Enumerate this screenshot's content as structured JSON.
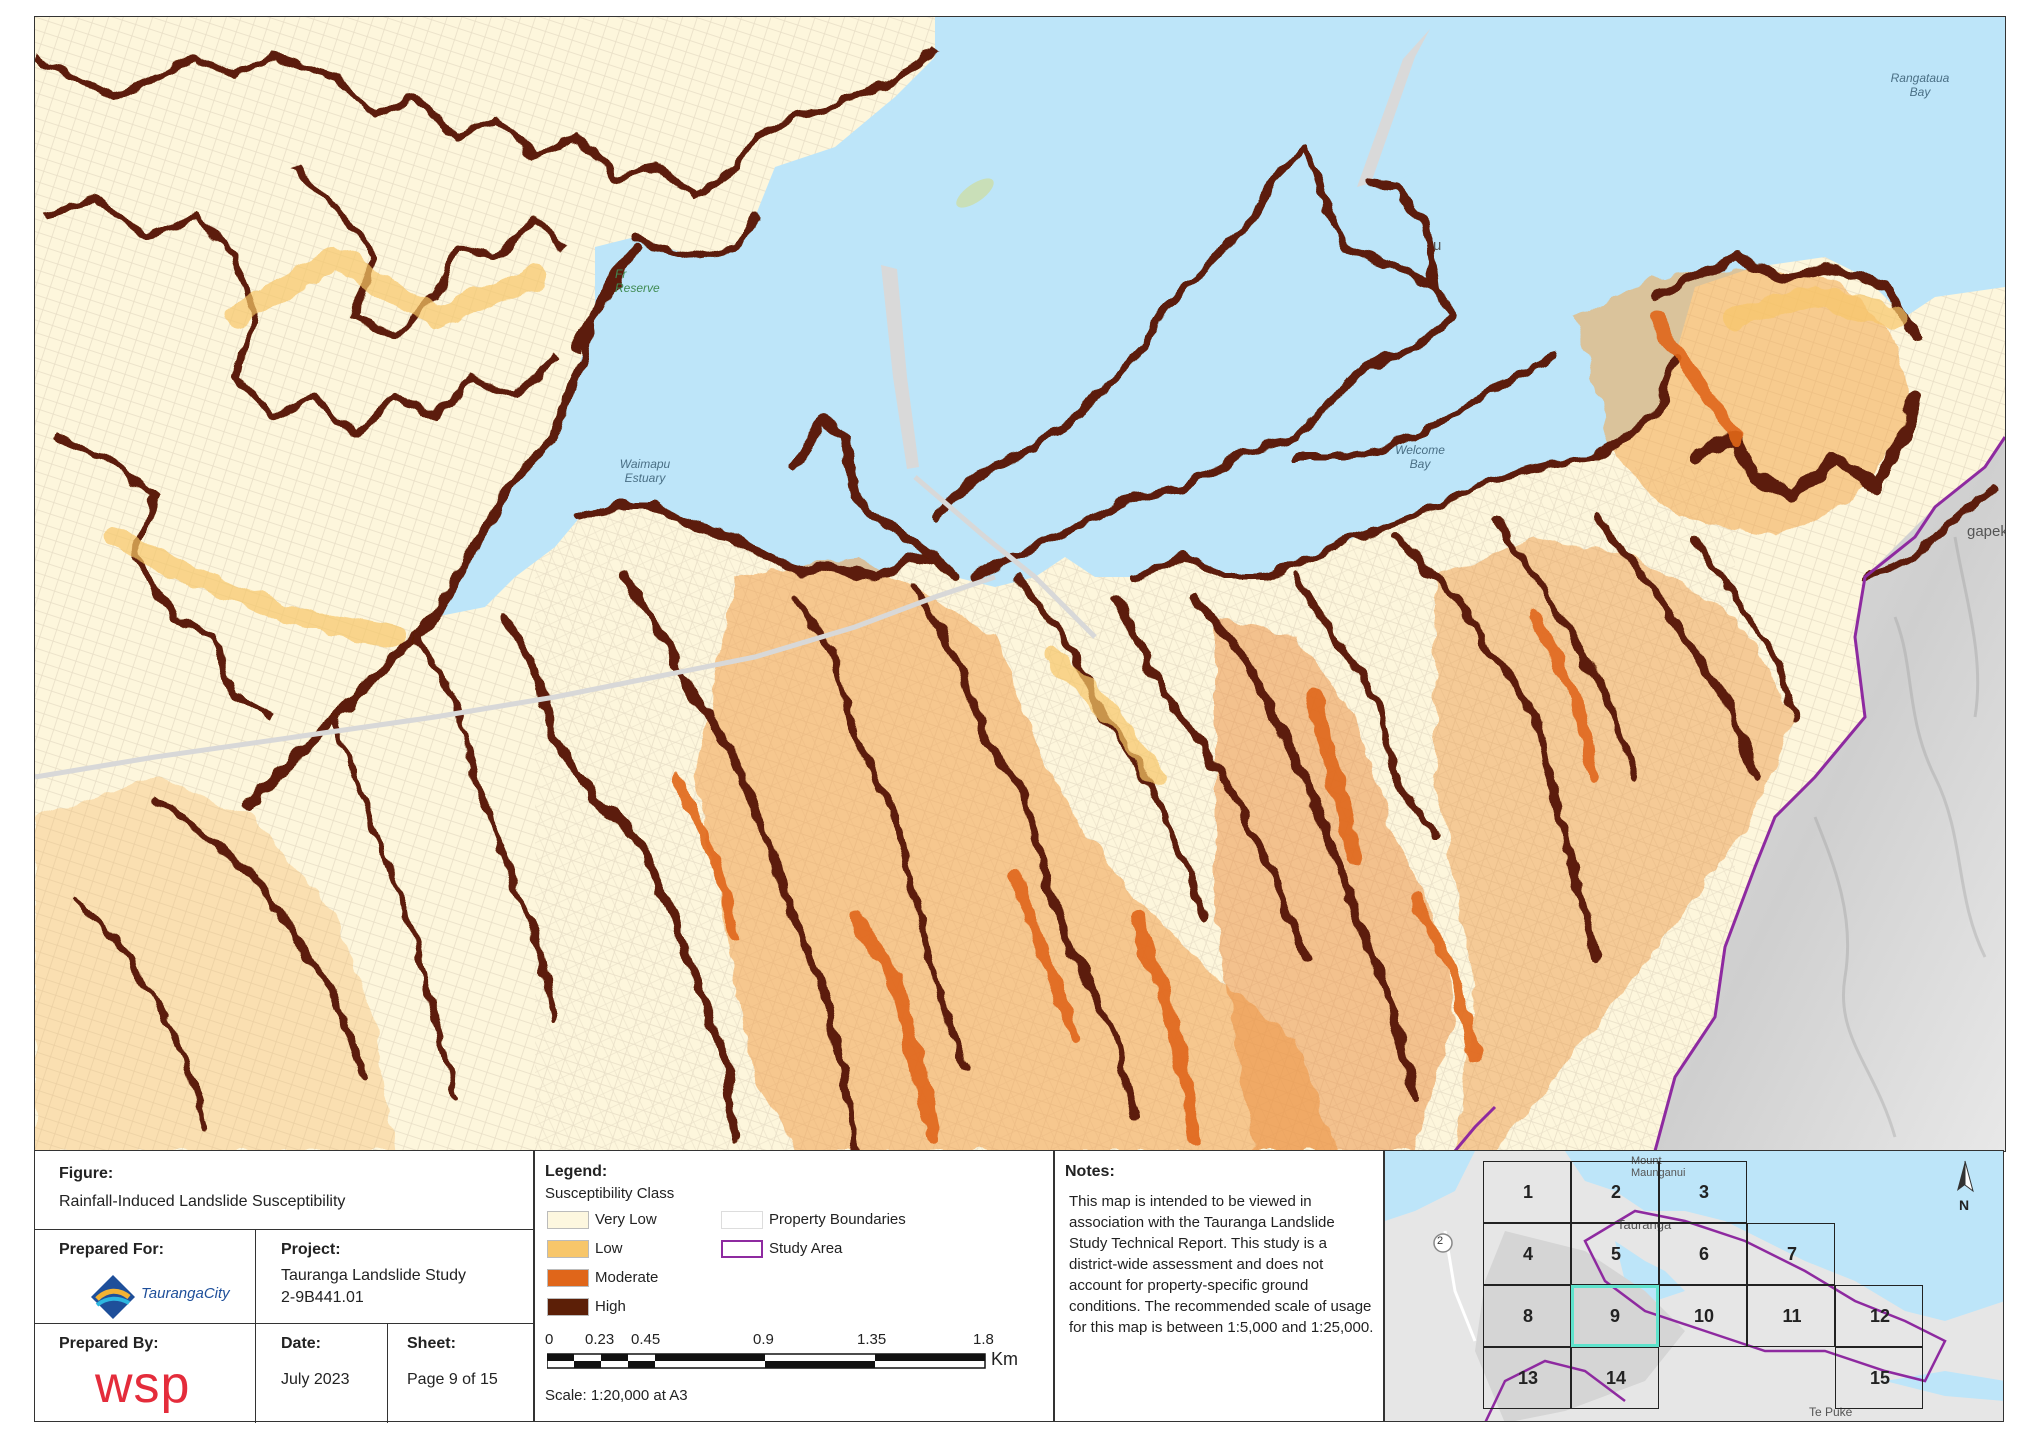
{
  "map": {
    "place_labels": {
      "rangataua_bay": "Rangataua\nBay",
      "waimapu_estuary": "Waimapu\nEstuary",
      "welcome_bay": "Welcome\nBay",
      "fraser_reserve": "Fr\nReserve",
      "papeke": "gapek",
      "matapihi": "u"
    },
    "colors": {
      "water": "#bde5f9",
      "very_low": "#fdf6dc",
      "low": "#f6c467",
      "moderate": "#e06a14",
      "high": "#5a1e05",
      "terrain": "#dcdcdc",
      "study_area": "#8e2aa0"
    }
  },
  "figure": {
    "label": "Figure:",
    "title": "Rainfall-Induced Landslide Susceptibility"
  },
  "prepared_for": {
    "label": "Prepared For:",
    "logo_text": "TaurangaCity"
  },
  "project": {
    "label": "Project:",
    "name": "Tauranga Landslide Study",
    "number": "2-9B441.01"
  },
  "prepared_by": {
    "label": "Prepared By:",
    "logo_text": "wsp"
  },
  "date": {
    "label": "Date:",
    "value": "July 2023"
  },
  "sheet": {
    "label": "Sheet:",
    "value": "Page 9 of 15"
  },
  "legend": {
    "title": "Legend:",
    "subtitle": "Susceptibility Class",
    "classes": [
      {
        "label": "Very Low",
        "color": "#fdf7df"
      },
      {
        "label": "Low",
        "color": "#f7c66a"
      },
      {
        "label": "Moderate",
        "color": "#e0661a"
      },
      {
        "label": "High",
        "color": "#5c1f07"
      }
    ],
    "property_boundaries": "Property Boundaries",
    "study_area": "Study Area",
    "scale_ticks": [
      "0",
      "0.23",
      "0.45",
      "0.9",
      "1.35",
      "1.8"
    ],
    "scale_unit": "Km",
    "scale_text": "Scale: 1:20,000 at A3"
  },
  "notes": {
    "label": "Notes:",
    "text": "This map is intended to be viewed in association with the Tauranga Landslide Study Technical Report. This study is a district-wide assessment and does not account for property-specific ground conditions. The recommended scale of usage for this map is between 1:5,000 and 1:25,000."
  },
  "index_map": {
    "sheets": [
      "1",
      "2",
      "3",
      "4",
      "5",
      "6",
      "7",
      "8",
      "9",
      "10",
      "11",
      "12",
      "13",
      "14",
      "15"
    ],
    "selected": "9",
    "place_labels": {
      "mount": "Mount\nMaunganui",
      "tauranga": "Tauranga",
      "te_puke": "Te Puke",
      "road": "2"
    },
    "north": "N"
  }
}
